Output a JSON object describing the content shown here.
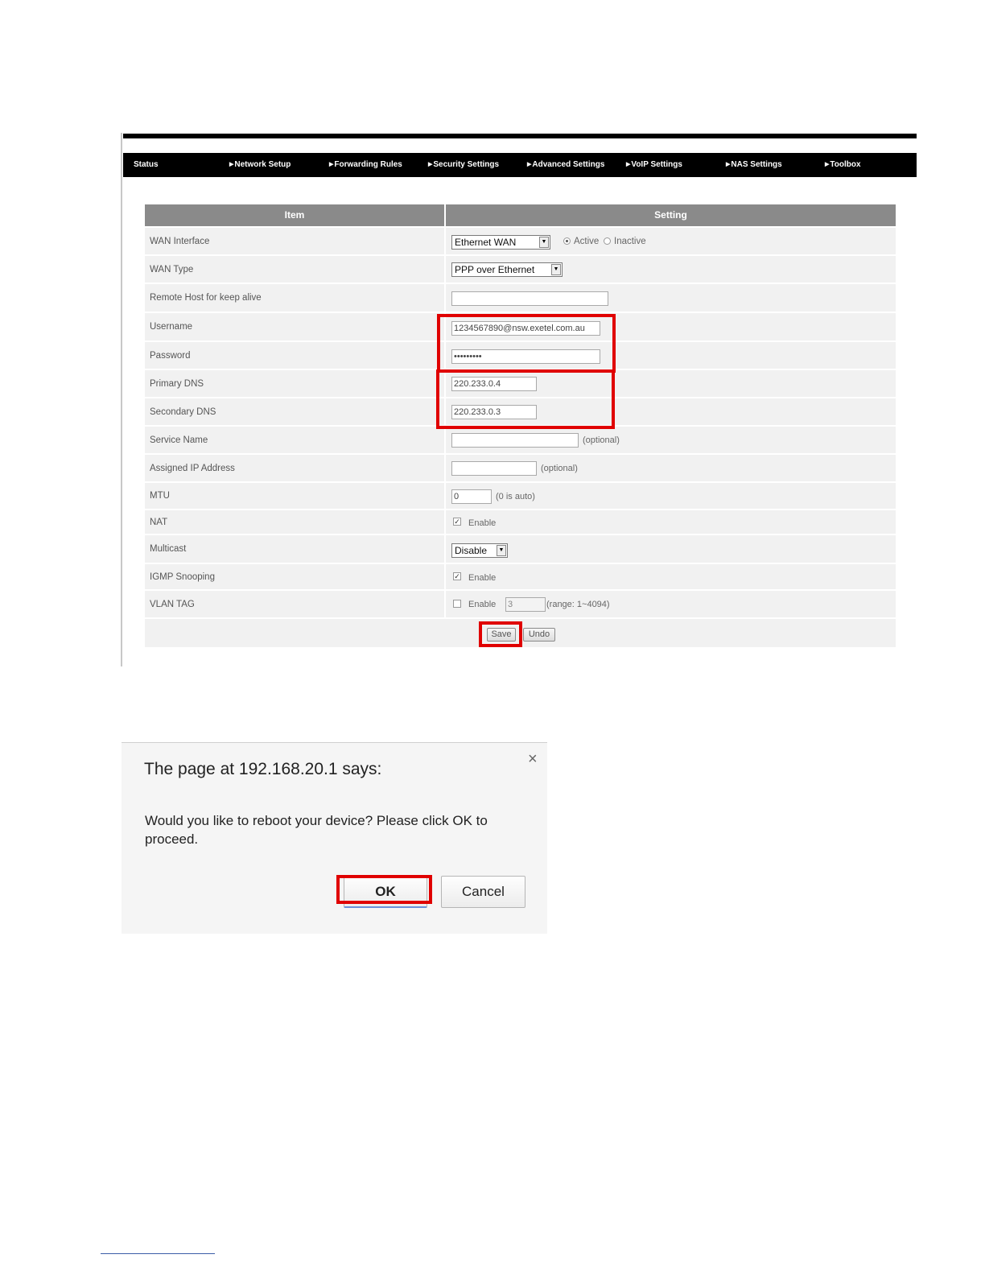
{
  "nav": {
    "items": [
      {
        "label": "Status",
        "arrow": false
      },
      {
        "label": "Network Setup",
        "arrow": true
      },
      {
        "label": "Forwarding Rules",
        "arrow": true
      },
      {
        "label": "Security Settings",
        "arrow": true
      },
      {
        "label": "Advanced Settings",
        "arrow": true
      },
      {
        "label": "VoIP Settings",
        "arrow": true
      },
      {
        "label": "NAS Settings",
        "arrow": true
      },
      {
        "label": "Toolbox",
        "arrow": true
      }
    ]
  },
  "table": {
    "header_item": "Item",
    "header_setting": "Setting",
    "rows": {
      "wan_interface": {
        "label": "WAN Interface",
        "value": "Ethernet WAN",
        "active": "Active",
        "inactive": "Inactive",
        "state": "Active"
      },
      "wan_type": {
        "label": "WAN Type",
        "value": "PPP over Ethernet"
      },
      "remote_host": {
        "label": "Remote Host for keep alive",
        "value": ""
      },
      "username": {
        "label": "Username",
        "value": "1234567890@nsw.exetel.com.au"
      },
      "password": {
        "label": "Password",
        "value": "•••••••••"
      },
      "primary_dns": {
        "label": "Primary DNS",
        "value": "220.233.0.4"
      },
      "secondary_dns": {
        "label": "Secondary DNS",
        "value": "220.233.0.3"
      },
      "service_name": {
        "label": "Service Name",
        "value": "",
        "note": "(optional)"
      },
      "assigned_ip": {
        "label": "Assigned IP Address",
        "value": "",
        "note": "(optional)"
      },
      "mtu": {
        "label": "MTU",
        "value": "0",
        "note": "(0 is auto)"
      },
      "nat": {
        "label": "NAT",
        "checkbox_label": "Enable",
        "checked": true
      },
      "multicast": {
        "label": "Multicast",
        "value": "Disable"
      },
      "igmp": {
        "label": "IGMP Snooping",
        "checkbox_label": "Enable",
        "checked": true
      },
      "vlan": {
        "label": "VLAN TAG",
        "checkbox_label": "Enable",
        "checked": false,
        "value": "3",
        "note": "(range: 1~4094)"
      }
    },
    "save_label": "Save",
    "undo_label": "Undo"
  },
  "dialog": {
    "title": "The page at 192.168.20.1 says:",
    "message": "Would you like to reboot your device? Please click OK to proceed.",
    "ok_label": "OK",
    "cancel_label": "Cancel",
    "close_glyph": "×"
  },
  "colors": {
    "highlight": "#e00000",
    "nav_bg": "#000000",
    "header_bg": "#8a8a8a",
    "row_bg": "#f1f1f1"
  }
}
